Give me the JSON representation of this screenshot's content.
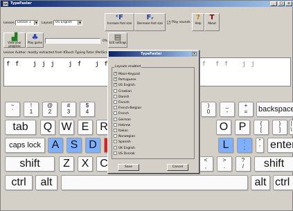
{
  "window": {
    "title": "TypeFaster",
    "min_label": "_",
    "max_label": "□",
    "close_label": "x"
  },
  "toolbar": {
    "lesson_label": "Lesson:",
    "lesson_value": "Lesson 1",
    "layout_label": "Layout:",
    "layout_value": "US English",
    "increase_font_label": "Increase font size",
    "decrease_font_label": "Decrease font size",
    "play_sounds_label": "Play sounds",
    "help_label": "Help",
    "about_label": "About",
    "view_progress_label": "View your progress",
    "play_game_label": "Play game",
    "percent_value": "0%",
    "edit_settings_label": "Edit settings"
  },
  "intro_text": "Lesson Author: mostly extracted from KTouch Typing Tutor (PerlScript...",
  "drill_text": "f f   j j j   j f   j f j   j",
  "drill_text_right": "j f f  f f   j j",
  "dialog": {
    "title": "TypeFaster",
    "close_label": "x",
    "group_label": "Layouts enabled",
    "options": [
      {
        "label": "Maori-Keypad",
        "checked": true
      },
      {
        "label": "Portuguese",
        "checked": true
      },
      {
        "label": "US English",
        "checked": true
      },
      {
        "label": "Croatian",
        "checked": false
      },
      {
        "label": "Danish",
        "checked": false
      },
      {
        "label": "Finnish",
        "checked": false
      },
      {
        "label": "French-Belgian",
        "checked": false
      },
      {
        "label": "French",
        "checked": false
      },
      {
        "label": "German",
        "checked": false
      },
      {
        "label": "Hebrew",
        "checked": false
      },
      {
        "label": "Italian",
        "checked": false
      },
      {
        "label": "Norwegian",
        "checked": false
      },
      {
        "label": "Spanish",
        "checked": false
      },
      {
        "label": "UK English",
        "checked": false
      },
      {
        "label": "US Dvorak",
        "checked": false
      }
    ],
    "save_label": "Save",
    "cancel_label": "Cancel"
  },
  "keyboard": {
    "row1": [
      {
        "top": "~",
        "bot": "`"
      },
      {
        "top": "!",
        "bot": "1"
      },
      {
        "top": "@",
        "bot": "2"
      },
      {
        "top": "#",
        "bot": "3"
      },
      {
        "top": "$",
        "bot": "4"
      },
      {
        "top": ")",
        "bot": "0"
      },
      {
        "top": "_",
        "bot": "-"
      },
      {
        "top": "+",
        "bot": "="
      }
    ],
    "backspace": "backspace",
    "tab": "tab",
    "row2": [
      "Q",
      "W",
      "E",
      "R"
    ],
    "row2_right": [
      "O",
      "P"
    ],
    "brackets": [
      {
        "top": "{",
        "bot": "["
      },
      {
        "top": "}",
        "bot": "]"
      },
      {
        "top": "|",
        "bot": "\\"
      }
    ],
    "caps": "caps lock",
    "row3": [
      "A",
      "S",
      "D"
    ],
    "row3_right": [
      "L"
    ],
    "semi": {
      "top": ":",
      "bot": ";"
    },
    "quote": {
      "top": "\"",
      "bot": "'"
    },
    "enter": "enter",
    "shift_left": "shift",
    "row4": [
      "Z",
      "X",
      "C"
    ],
    "row4_right": [
      {
        "top": "<",
        "bot": ","
      },
      {
        "top": ">",
        "bot": "."
      },
      {
        "top": "?",
        "bot": "/"
      }
    ],
    "shift_right": "shift",
    "ctrl_left": "ctrl",
    "alt_left": "alt",
    "alt_right": "alt",
    "ctrl_right": "ctrl",
    "highlight_red": "#e02020",
    "highlight_blue": "#7fb0ff"
  }
}
